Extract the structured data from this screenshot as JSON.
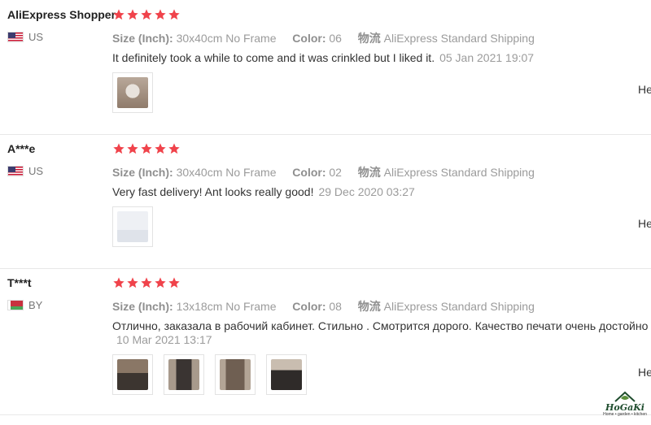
{
  "reviews": [
    {
      "user": "AliExpress Shopper",
      "country": "US",
      "rating": 5,
      "size_label": "Size (Inch):",
      "size_value": "30x40cm No Frame",
      "color_label": "Color:",
      "color_value": "06",
      "shipping_label": "物流",
      "shipping_value": "AliExpress Standard Shipping",
      "text": "It definitely took a while to come and it was crinkled but I liked it.",
      "date": "05 Jan 2021 19:07",
      "photos": [
        {
          "icon": "poster-on-wall-photo"
        }
      ],
      "helpful": "He"
    },
    {
      "user": "A***e",
      "country": "US",
      "rating": 5,
      "size_label": "Size (Inch):",
      "size_value": "30x40cm No Frame",
      "color_label": "Color:",
      "color_value": "02",
      "shipping_label": "物流",
      "shipping_value": "AliExpress Standard Shipping",
      "text": "Very fast delivery! Ant looks really good!",
      "date": "29 Dec 2020 03:27",
      "photos": [
        {
          "icon": "bedroom-wall-photo"
        }
      ],
      "helpful": "He"
    },
    {
      "user": "T***t",
      "country": "BY",
      "rating": 5,
      "size_label": "Size (Inch):",
      "size_value": "13x18cm No Frame",
      "color_label": "Color:",
      "color_value": "08",
      "shipping_label": "物流",
      "shipping_value": "AliExpress Standard Shipping",
      "text": "Отлично, заказала в рабочий кабинет. Стильно . Смотрится дорого. Качество печати очень достойно",
      "date": "10 Mar 2021 13:17",
      "photos": [
        {
          "icon": "desk-poster-photo"
        },
        {
          "icon": "framed-poster-photo"
        },
        {
          "icon": "figure-poster-photo"
        },
        {
          "icon": "wall-poster-photo"
        }
      ],
      "helpful": "He"
    }
  ],
  "colors": {
    "star": "#f0434b",
    "accent_text": "#9b9b9b"
  },
  "logo": {
    "word": "HoGaKi",
    "tagline": "Home • garden • kitchen"
  }
}
